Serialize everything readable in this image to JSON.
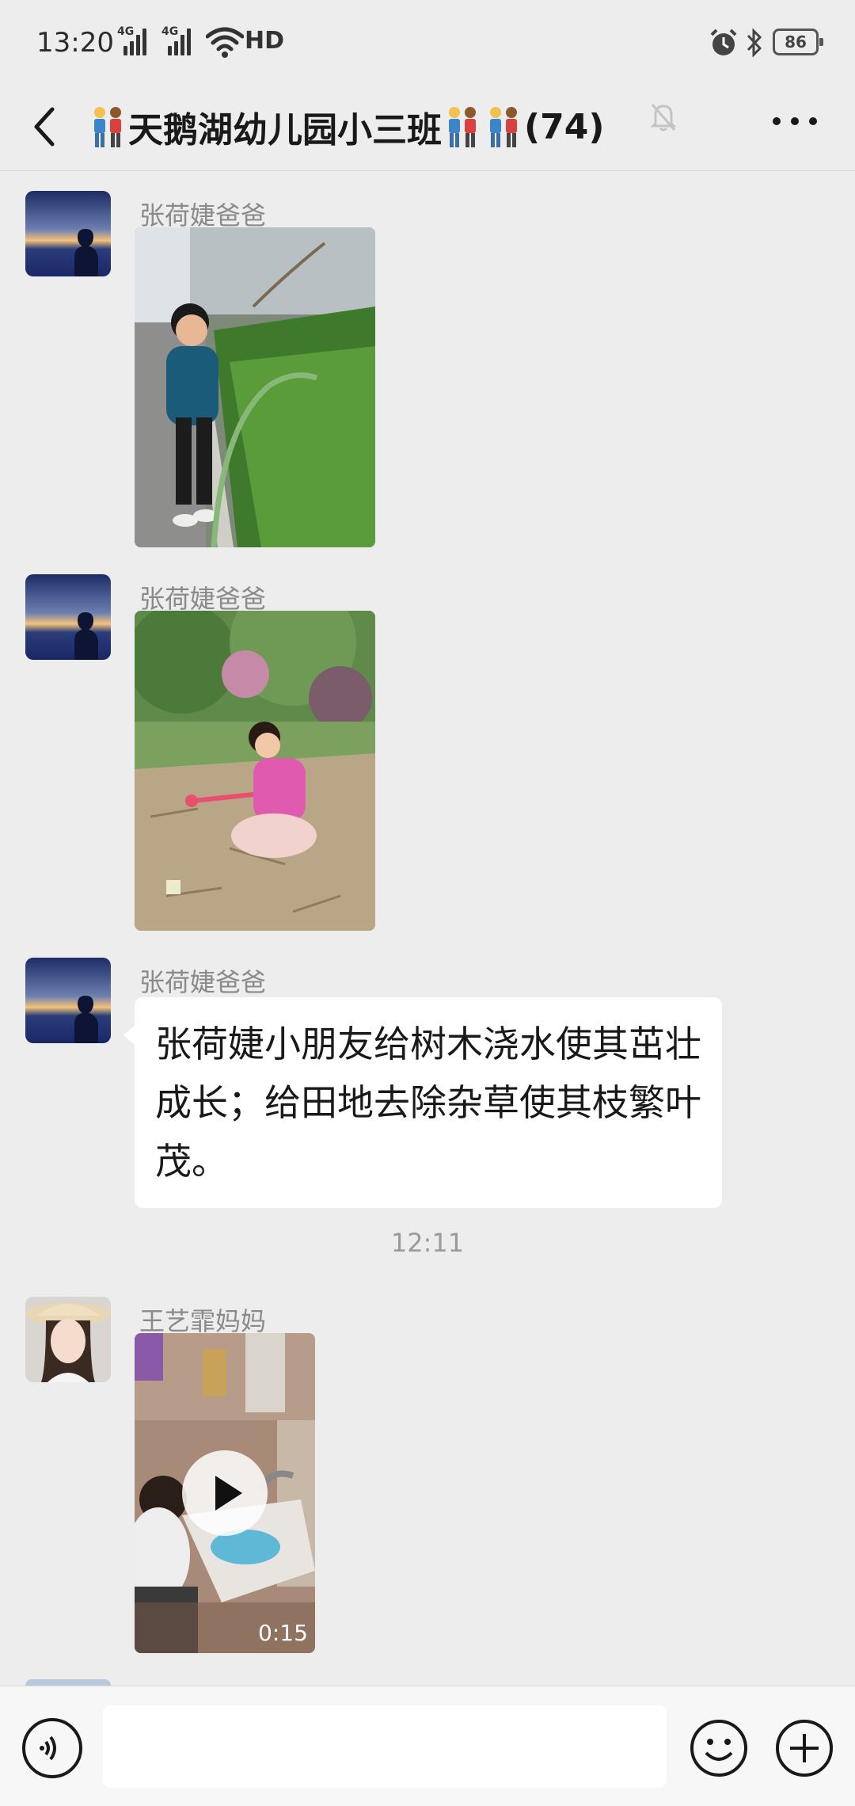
{
  "status_bar": {
    "time": "13:20",
    "network_1": "4G",
    "network_2": "4G",
    "hd": "HD",
    "battery": "86"
  },
  "nav": {
    "title": "天鹅湖幼儿园小三班",
    "member_count": "(74)"
  },
  "messages": [
    {
      "type": "image",
      "sender": "张荷婕爸爸",
      "avatar": "sunset-silhouette",
      "image": "boy-watering-hedge"
    },
    {
      "type": "image",
      "sender": "张荷婕爸爸",
      "avatar": "sunset-silhouette",
      "image": "girl-weeding-soil"
    },
    {
      "type": "text",
      "sender": "张荷婕爸爸",
      "avatar": "sunset-silhouette",
      "text": "张荷婕小朋友给树木浇水使其茁壮成长；给田地去除杂草使其枝繁叶茂。"
    },
    {
      "type": "timestamp",
      "text": "12:11"
    },
    {
      "type": "video",
      "sender": "王艺霏妈妈",
      "avatar": "woman-with-hat",
      "duration": "0:15"
    }
  ],
  "input": {
    "placeholder": ""
  },
  "colors": {
    "background": "#ededed",
    "bubble": "#ffffff",
    "sender_text": "#8a8a8a",
    "timestamp_text": "#9a9a9a"
  }
}
